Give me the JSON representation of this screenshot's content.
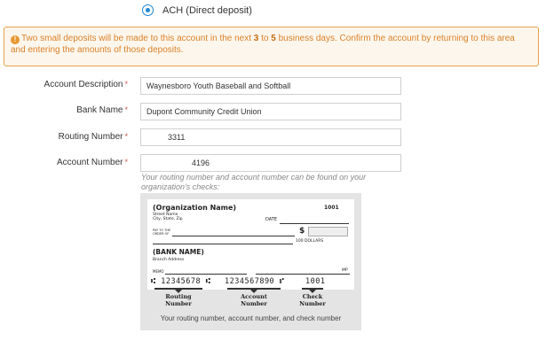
{
  "payment_method": {
    "selected_label": "ACH (Direct deposit)"
  },
  "alert": {
    "text_before": "Two small deposits will be made to this account in the next ",
    "days_min": "3",
    "text_to": " to ",
    "days_max": "5",
    "text_after": " business days. Confirm the account by returning to this area and entering the amounts of those deposits.",
    "color": "#d9822b"
  },
  "form": {
    "required_marker": "*",
    "account_description": {
      "label": "Account Description",
      "value": "Waynesboro Youth Baseball and Softball"
    },
    "bank_name": {
      "label": "Bank Name",
      "value": "Dupont Community Credit Union"
    },
    "routing_number": {
      "label": "Routing Number",
      "value": "3311"
    },
    "account_number": {
      "label": "Account Number",
      "value": "4196"
    },
    "hint": "Your routing number and account number can be found on your organization's checks:"
  },
  "check_illustration": {
    "org_name": "(Organization Name)",
    "org_address_1": "Street Name",
    "org_address_2": "City, State, Zip",
    "check_number": "1001",
    "date_label": "DATE",
    "pay_to_1": "PAY TO THE",
    "pay_to_2": "ORDER OF",
    "dollar_sign": "$",
    "dollars_label": "100 DOLLARS",
    "bank_name": "(BANK NAME)",
    "bank_address": "Branch Address",
    "memo_label": "MEMO",
    "mp_label": "MP",
    "micr_routing": "⑆ 12345678 ⑆",
    "micr_account": "1234567890 ⑈",
    "micr_check": "1001",
    "routing_caption_1": "Routing",
    "routing_caption_2": "Number",
    "account_caption_1": "Account",
    "account_caption_2": "Number",
    "check_caption_1": "Check",
    "check_caption_2": "Number",
    "panel_caption": "Your routing number, account number, and check number"
  }
}
